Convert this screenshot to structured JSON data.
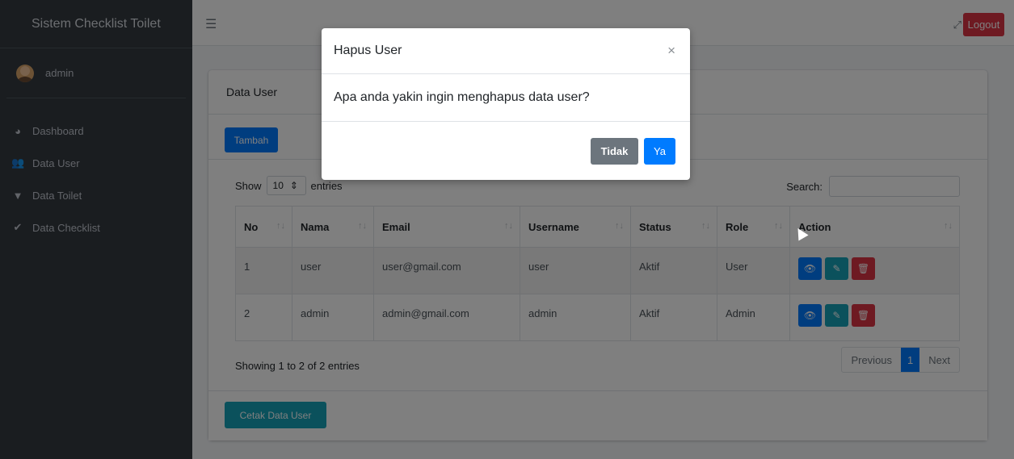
{
  "sidebar": {
    "brand": "Sistem Checklist Toilet",
    "user": "admin",
    "items": [
      {
        "label": "Dashboard",
        "icon": "dashboard-icon"
      },
      {
        "label": "Data User",
        "icon": "users-icon"
      },
      {
        "label": "Data Toilet",
        "icon": "toilet-icon"
      },
      {
        "label": "Data Checklist",
        "icon": "check-icon"
      }
    ]
  },
  "topbar": {
    "logout_label": "Logout",
    "menu_icon": "hamburger-icon",
    "fullscreen_icon": "expand-icon"
  },
  "card": {
    "title": "Data User",
    "add_label": "Tambah",
    "show_label": "Show",
    "entries_count": "10",
    "entries_label": "entries",
    "search_label": "Search:",
    "search_value": "",
    "columns": [
      "No",
      "Nama",
      "Email",
      "Username",
      "Status",
      "Role",
      "Action"
    ],
    "rows": [
      [
        "1",
        "user",
        "user@gmail.com",
        "user",
        "Aktif",
        "User"
      ],
      [
        "2",
        "admin",
        "admin@gmail.com",
        "admin",
        "Aktif",
        "Admin"
      ]
    ],
    "info_text": "Showing 1 to 2 of 2 entries",
    "pagination": {
      "previous": "Previous",
      "current": "1",
      "next": "Next"
    },
    "print_label": "Cetak Data User"
  },
  "modal": {
    "title": "Hapus User",
    "close_symbol": "×",
    "message": "Apa anda yakin ingin menghapus data user?",
    "no_label": "Tidak",
    "yes_label": "Ya"
  },
  "colors": {
    "primary": "#007bff",
    "info": "#17a2b8",
    "danger": "#dc3545",
    "secondary": "#6c757d",
    "sidebar": "#343a40"
  }
}
